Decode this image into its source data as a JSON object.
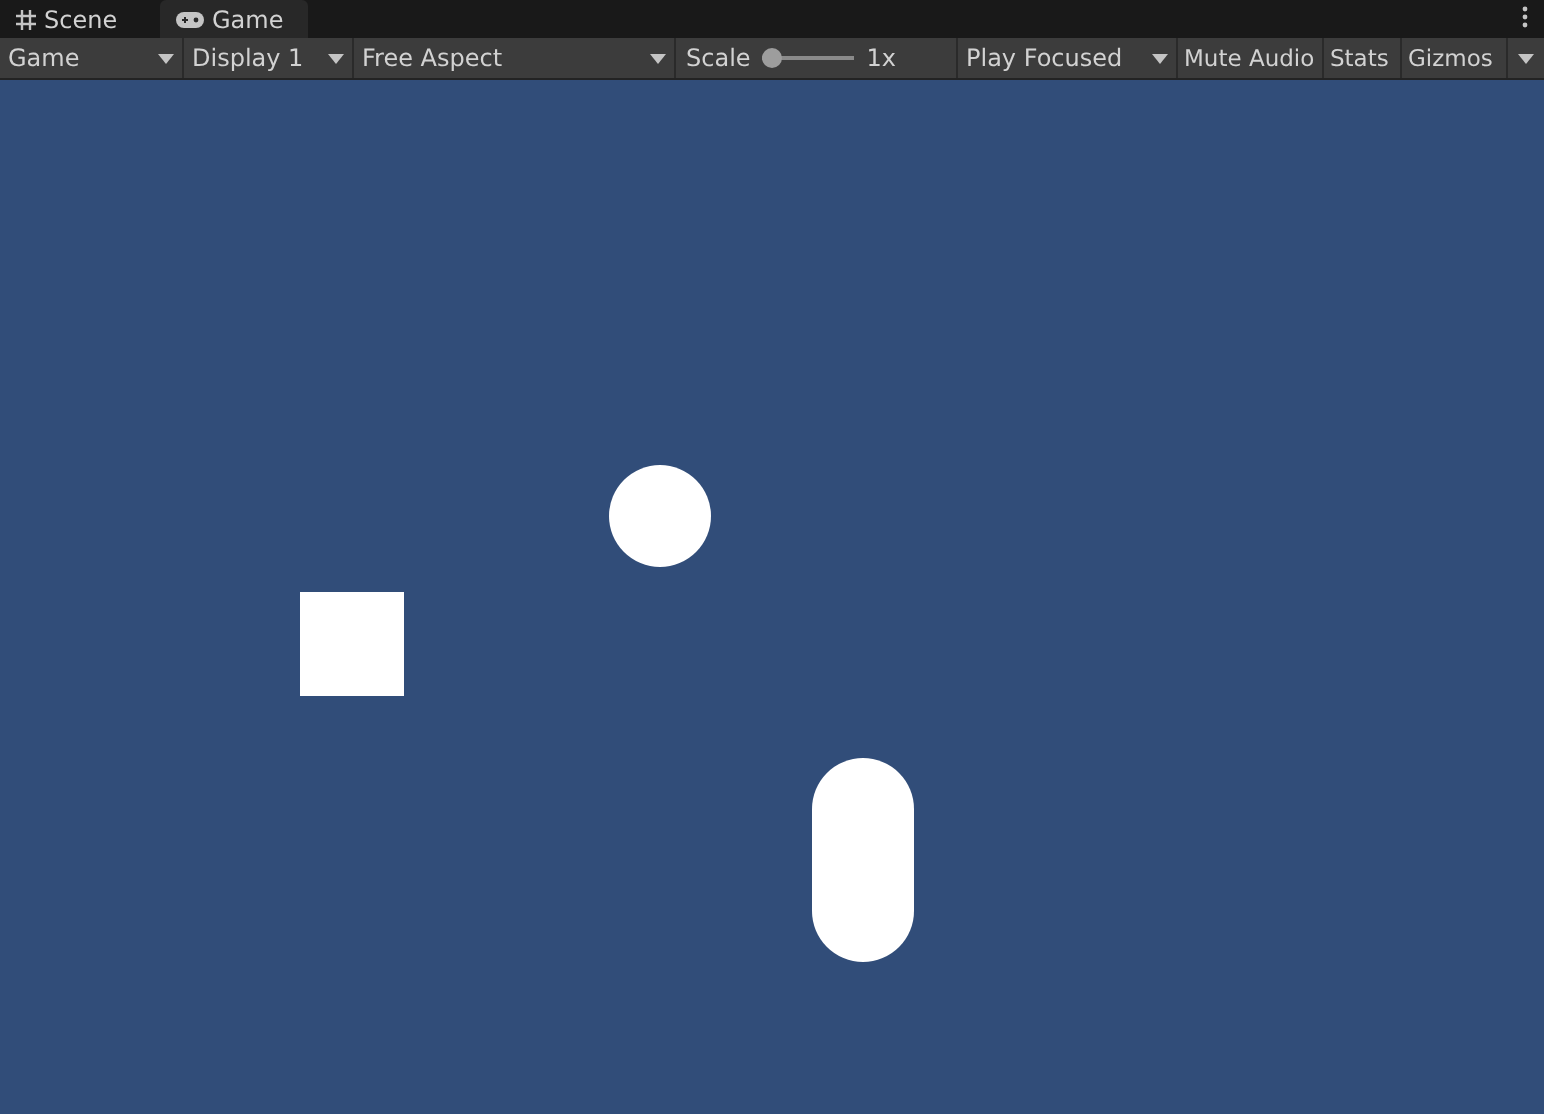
{
  "tabs": [
    {
      "label": "Scene",
      "selected": false
    },
    {
      "label": "Game",
      "selected": true
    }
  ],
  "toolbar": {
    "view_dropdown": "Game",
    "display_dropdown": "Display 1",
    "aspect_dropdown": "Free Aspect",
    "scale": {
      "label": "Scale",
      "level": 0,
      "reading": "1x"
    },
    "play_mode_dropdown": "Play Focused",
    "mute_audio": {
      "label": "Mute Audio",
      "on": false
    },
    "stats": {
      "label": "Stats",
      "on": false
    },
    "gizmos": {
      "label": "Gizmos",
      "on": false
    }
  }
}
